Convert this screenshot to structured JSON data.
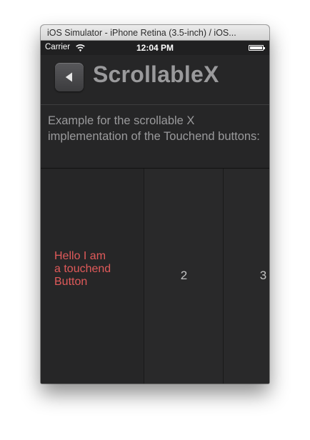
{
  "window": {
    "title": "iOS Simulator - iPhone Retina (3.5-inch) / iOS..."
  },
  "status_bar": {
    "carrier": "Carrier",
    "time": "12:04 PM",
    "wifi_icon": "wifi-icon",
    "battery_icon": "battery-icon",
    "battery_level": 1.0
  },
  "nav": {
    "back_icon": "back-arrow-icon",
    "title": "ScrollableX"
  },
  "description": "Example for the scrollable X implementation of the Touchend buttons:",
  "tiles": [
    {
      "label": "Hello I am a touchend Button",
      "color": "#e05a5a"
    },
    {
      "label": "2",
      "color": "#c3c3c3"
    },
    {
      "label": "3",
      "color": "#c3c3c3"
    }
  ]
}
